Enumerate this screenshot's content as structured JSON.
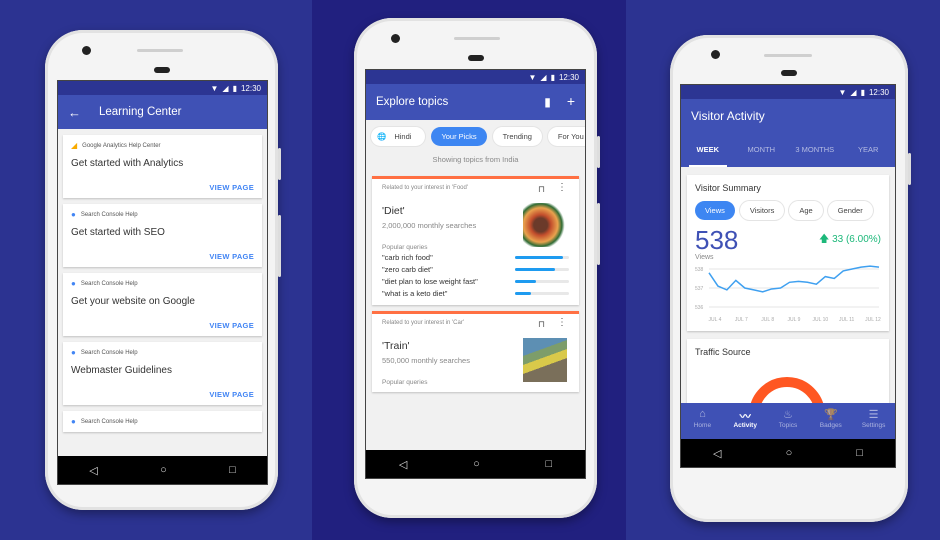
{
  "status_bar": {
    "time": "12:30"
  },
  "learning_center": {
    "title": "Learning Center",
    "cards": [
      {
        "source": "Google Analytics Help Center",
        "source_icon": "analytics-icon",
        "title": "Get started with Analytics",
        "action": "VIEW PAGE"
      },
      {
        "source": "Search Console Help",
        "source_icon": "search-console-icon",
        "title": "Get started with SEO",
        "action": "VIEW PAGE"
      },
      {
        "source": "Search Console Help",
        "source_icon": "search-console-icon",
        "title": "Get your website on Google",
        "action": "VIEW PAGE"
      },
      {
        "source": "Search Console Help",
        "source_icon": "search-console-icon",
        "title": "Webmaster Guidelines",
        "action": "VIEW PAGE"
      },
      {
        "source": "Search Console Help",
        "source_icon": "search-console-icon"
      }
    ]
  },
  "explore_topics": {
    "title": "Explore topics",
    "chips": [
      {
        "label": "Hindi",
        "icon": "globe-icon",
        "active": false
      },
      {
        "label": "Your Picks",
        "active": true
      },
      {
        "label": "Trending",
        "active": false
      },
      {
        "label": "For You",
        "active": false
      }
    ],
    "region_note": "Showing topics from India",
    "topics": [
      {
        "related": "Related to your interest in 'Food'",
        "title": "'Diet'",
        "searches": "2,000,000 monthly searches",
        "popular_label": "Popular queries",
        "queries": [
          {
            "text": "\"carb rich food\"",
            "share": 0.88
          },
          {
            "text": "\"zero carb diet\"",
            "share": 0.74
          },
          {
            "text": "\"diet plan to lose weight fast\"",
            "share": 0.38
          },
          {
            "text": "\"what is a keto diet\"",
            "share": 0.3
          }
        ]
      },
      {
        "related": "Related to your interest in 'Car'",
        "title": "'Train'",
        "searches": "550,000 monthly searches",
        "popular_label": "Popular queries"
      }
    ]
  },
  "visitor_activity": {
    "title": "Visitor Activity",
    "tabs": [
      {
        "label": "WEEK",
        "active": true
      },
      {
        "label": "MONTH",
        "active": false
      },
      {
        "label": "3 MONTHS",
        "active": false
      },
      {
        "label": "YEAR",
        "active": false
      }
    ],
    "summary_title": "Visitor Summary",
    "chips": [
      {
        "label": "Views",
        "active": true
      },
      {
        "label": "Visitors",
        "active": false
      },
      {
        "label": "Age",
        "active": false
      },
      {
        "label": "Gender",
        "active": false
      }
    ],
    "big_value": "538",
    "big_label": "Views",
    "change": "33 (6.00%)",
    "change_color": "#1db87a",
    "accent": "#3f51b5",
    "chart": {
      "y_ticks": [
        "538",
        "537",
        "536"
      ],
      "y_range": [
        536,
        538
      ],
      "x_ticks": [
        "JUL 4",
        "JUL 7",
        "JUL 8",
        "JUL 9",
        "JUL 10",
        "JUL 11",
        "JUL 12"
      ],
      "values": [
        537.8,
        537.1,
        536.9,
        537.4,
        537.0,
        536.9,
        536.8,
        536.95,
        537.0,
        537.3,
        537.35,
        537.3,
        537.2,
        537.6,
        537.5,
        537.9,
        538.0,
        538.1,
        538.15,
        538.1
      ]
    },
    "traffic_title": "Traffic Source",
    "bottom_nav": [
      {
        "label": "Home",
        "glyph": "⌂",
        "icon": "home-icon",
        "active": false
      },
      {
        "label": "Activity",
        "glyph": "〰",
        "icon": "activity-icon",
        "active": true
      },
      {
        "label": "Topics",
        "glyph": "♨",
        "icon": "topics-icon",
        "active": false
      },
      {
        "label": "Badges",
        "glyph": "🏆",
        "icon": "badges-icon",
        "active": false
      },
      {
        "label": "Settings",
        "glyph": "☰",
        "icon": "settings-icon",
        "active": false
      }
    ]
  }
}
